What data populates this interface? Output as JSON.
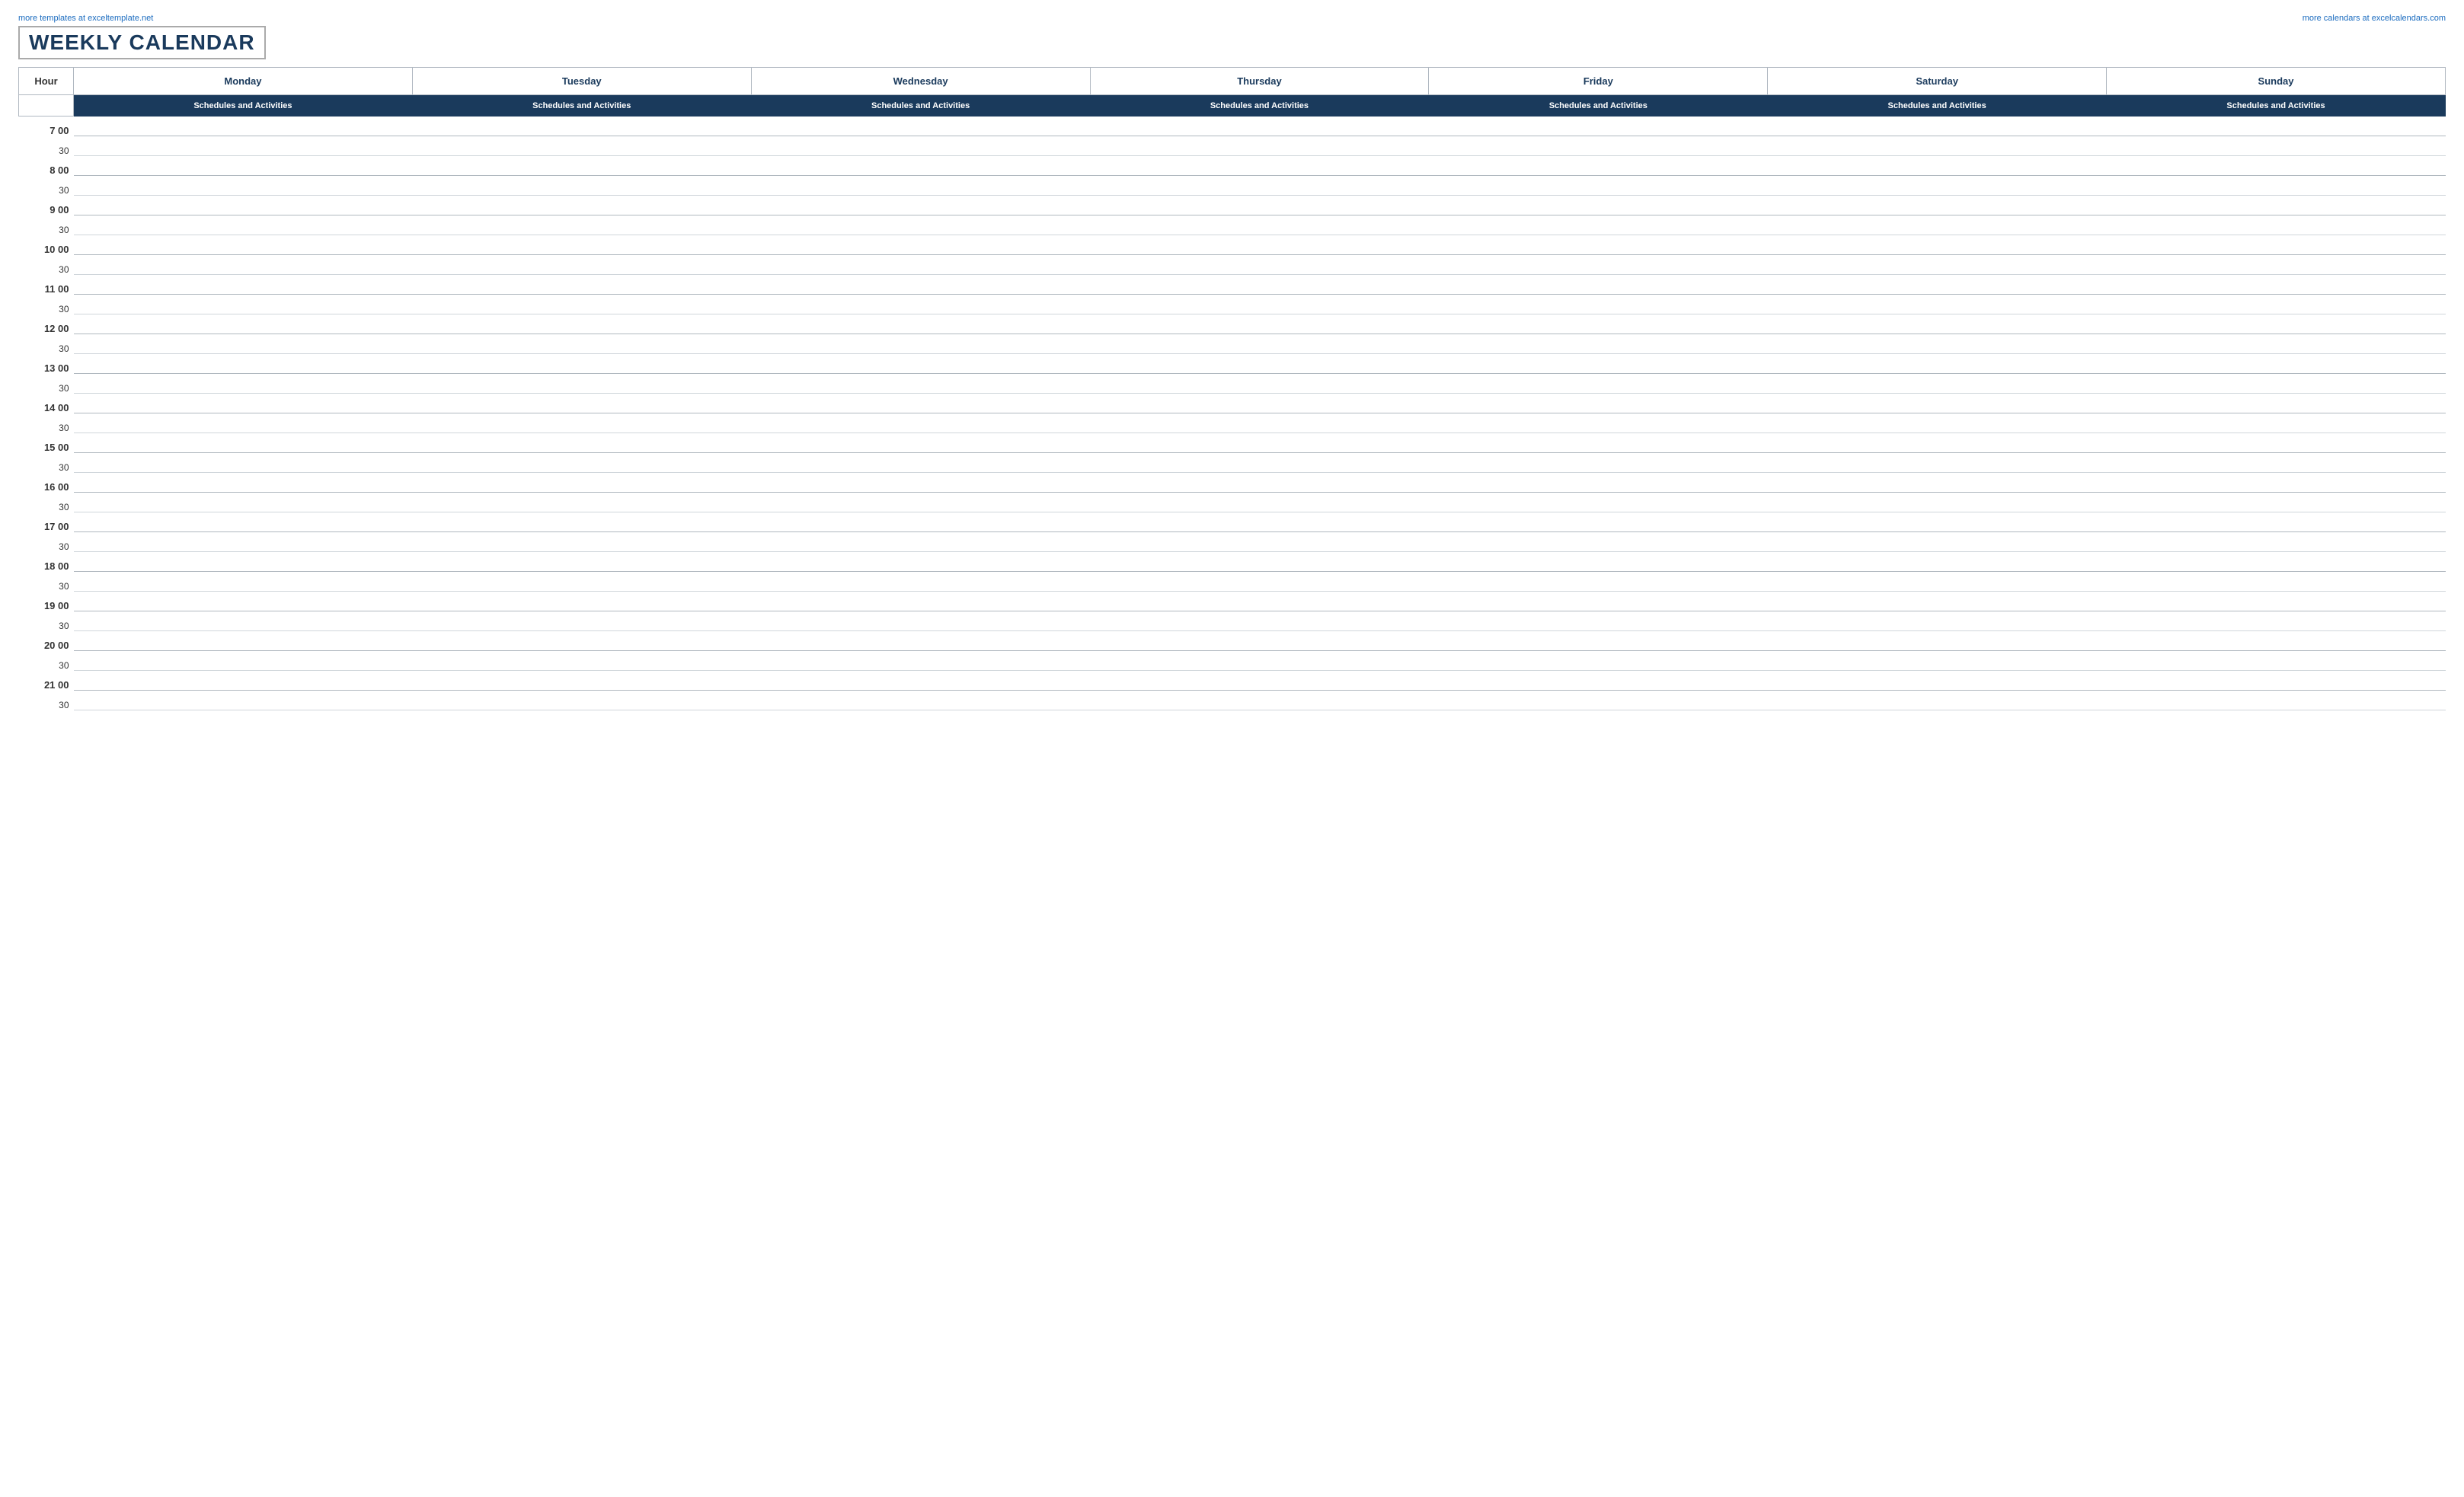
{
  "title": "WEEKLY CALENDAR",
  "link_left": "more templates at exceltemplate.net",
  "link_right": "more calendars at excelcalendars.com",
  "header": {
    "hour_label": "Hour",
    "days": [
      "Monday",
      "Tuesday",
      "Wednesday",
      "Thursday",
      "Friday",
      "Saturday",
      "Sunday"
    ],
    "sub_label": "Schedules and Activities"
  },
  "hours": [
    {
      "hour": "7",
      "label": "7  00"
    },
    {
      "hour": "8",
      "label": "8  00"
    },
    {
      "hour": "9",
      "label": "9  00"
    },
    {
      "hour": "10",
      "label": "10  00"
    },
    {
      "hour": "11",
      "label": "11  00"
    },
    {
      "hour": "12",
      "label": "12  00"
    },
    {
      "hour": "13",
      "label": "13  00"
    },
    {
      "hour": "14",
      "label": "14  00"
    },
    {
      "hour": "15",
      "label": "15  00"
    },
    {
      "hour": "16",
      "label": "16  00"
    },
    {
      "hour": "17",
      "label": "17  00"
    },
    {
      "hour": "18",
      "label": "18  00"
    },
    {
      "hour": "19",
      "label": "19  00"
    },
    {
      "hour": "20",
      "label": "20  00"
    },
    {
      "hour": "21",
      "label": "21  00"
    }
  ],
  "half_label": "30"
}
